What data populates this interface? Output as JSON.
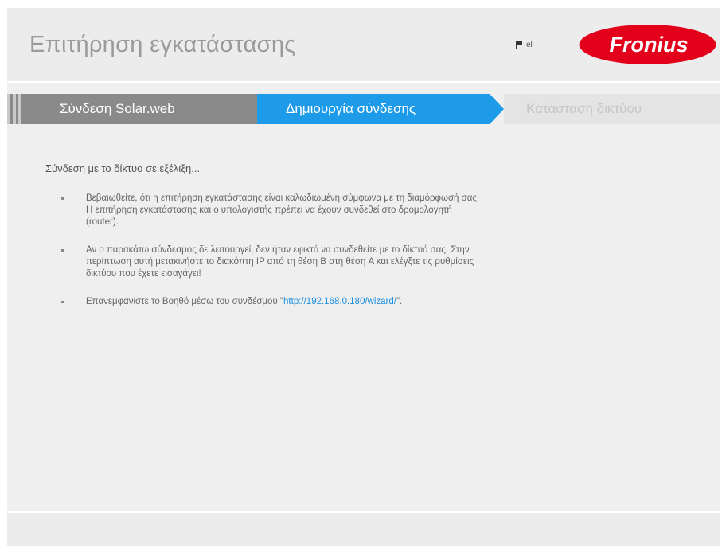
{
  "header": {
    "title": "Επιτήρηση εγκατάστασης",
    "language_code": "el",
    "flag_icon": "flag-icon",
    "logo_text": "Fronius",
    "logo_color": "#e2001a"
  },
  "wizard_steps": [
    {
      "label": "Σύνδεση Solar.web",
      "state": "done"
    },
    {
      "label": "Δημιουργία σύνδεσης",
      "state": "active"
    },
    {
      "label": "Κατάσταση δικτύου",
      "state": "inactive"
    }
  ],
  "colors": {
    "active_step": "#1e9be8",
    "done_step": "#8a8a8a",
    "inactive_step": "#e4e4e4",
    "link": "#1e90e0"
  },
  "content": {
    "status_heading": "Σύνδεση με το δίκτυο σε εξέλιξη...",
    "bullets": [
      {
        "line1": "Βεβαιωθείτε, ότι η επιτήρηση εγκατάστασης είναι καλωδιωμένη σύμφωνα με τη διαμόρφωσή σας.",
        "line2": "Η επιτήρηση εγκατάστασης και ο υπολογιστής πρέπει να έχουν συνδεθεί στο δρομολογητή",
        "line3": "(router)."
      },
      {
        "line1": "Αν ο παρακάτω σύνδεσμος δε λειτουργεί, δεν ήταν εφικτό να συνδεθείτε με το δίκτυό σας. Στην",
        "line2": "περίπτωση αυτή μετακινήστε το διακόπτη IP από τη θέση B στη θέση A και ελέγξτε τις ρυθμίσεις",
        "line3": "δικτύου που έχετε εισαγάγει!"
      },
      {
        "before": "Επανεμφανίστε το Βοηθό μέσω του συνδέσμου \"",
        "link": "http://192.168.0.180/wizard/",
        "after": "\"."
      }
    ]
  }
}
